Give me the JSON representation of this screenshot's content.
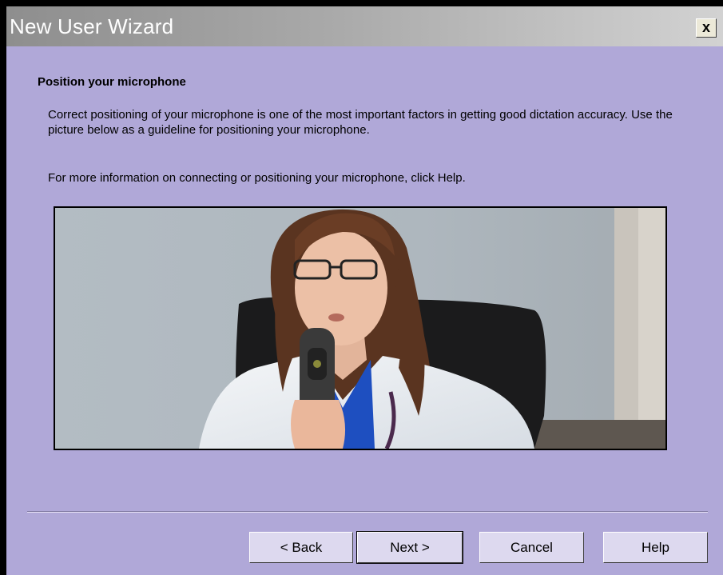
{
  "window": {
    "title": "New User Wizard",
    "close_label": "x"
  },
  "content": {
    "heading": "Position your microphone",
    "paragraph1": "Correct positioning of your microphone is one of the most important factors in getting good dictation accuracy.  Use the picture below as a guideline for positioning your microphone.",
    "paragraph2": "For more information on connecting or positioning your microphone, click Help."
  },
  "buttons": {
    "back": "< Back",
    "next": "Next >",
    "cancel": "Cancel",
    "help": "Help"
  },
  "colors": {
    "dialog_background": "#b0a8d8",
    "title_text": "#ffffff",
    "shirt_blue": "#1e4fc0"
  }
}
